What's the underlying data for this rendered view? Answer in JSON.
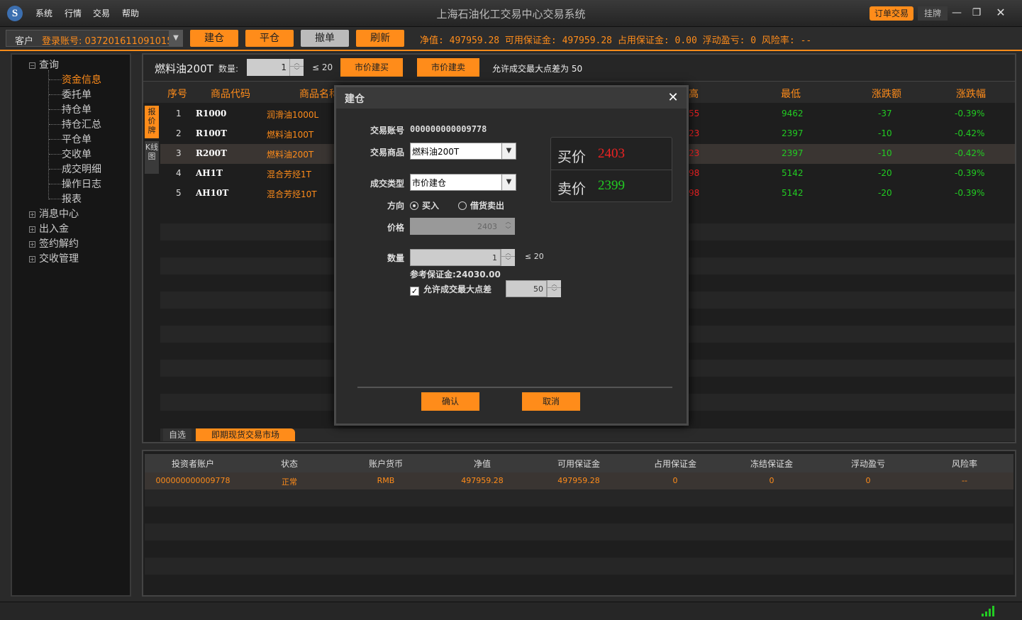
{
  "window": {
    "title": "上海石油化工交易中心交易系统",
    "menu": [
      "系统",
      "行情",
      "交易",
      "帮助"
    ],
    "tab_order": "订单交易",
    "tab_hang": "挂牌"
  },
  "toolbar": {
    "client_label": "客户",
    "account_text": "登录账号: 037201611091015",
    "btn_open": "建仓",
    "btn_close": "平仓",
    "btn_withdraw": "撤单",
    "btn_refresh": "刷新",
    "summary": "净值: 497959.28 可用保证金: 497959.28 占用保证金: 0.00 浮动盈亏: 0 风险率: --"
  },
  "sidebar": {
    "query": "查询",
    "children": [
      "资金信息",
      "委托单",
      "持仓单",
      "持仓汇总",
      "平仓单",
      "交收单",
      "成交明细",
      "操作日志",
      "报表"
    ],
    "groups": [
      "消息中心",
      "出入金",
      "签约解约",
      "交收管理"
    ]
  },
  "order_bar": {
    "product": "燃料油200T",
    "qty_label": "数量:",
    "qty_value": "1",
    "qty_max": "≤ 20",
    "btn_buy": "市价建买",
    "btn_sell": "市价建卖",
    "allow_text": "允许成交最大点差为 50"
  },
  "quote_table": {
    "headers": [
      "序号",
      "商品代码",
      "商品名称",
      "高",
      "最低",
      "涨跌额",
      "涨跌幅"
    ],
    "rows": [
      {
        "no": "1",
        "code": "R1000",
        "name": "润滑油1000L",
        "high": "55",
        "low": "9462",
        "chg": "-37",
        "pct": "-0.39%"
      },
      {
        "no": "2",
        "code": "R100T",
        "name": "燃料油100T",
        "high": "23",
        "low": "2397",
        "chg": "-10",
        "pct": "-0.42%"
      },
      {
        "no": "3",
        "code": "R200T",
        "name": "燃料油200T",
        "high": "23",
        "low": "2397",
        "chg": "-10",
        "pct": "-0.42%"
      },
      {
        "no": "4",
        "code": "AH1T",
        "name": "混合芳烃1T",
        "high": "98",
        "low": "5142",
        "chg": "-20",
        "pct": "-0.39%"
      },
      {
        "no": "5",
        "code": "AH10T",
        "name": "混合芳烃10T",
        "high": "98",
        "low": "5142",
        "chg": "-20",
        "pct": "-0.39%"
      }
    ],
    "side_tab1": "报价牌",
    "side_tab2": "K线图",
    "tab_self": "自选",
    "tab_market": "即期现货交易市场"
  },
  "account_table": {
    "headers": [
      "投资者账户",
      "状态",
      "账户货币",
      "净值",
      "可用保证金",
      "占用保证金",
      "冻结保证金",
      "浮动盈亏",
      "风险率"
    ],
    "row": [
      "000000000009778",
      "正常",
      "RMB",
      "497959.28",
      "497959.28",
      "0",
      "0",
      "0",
      "--"
    ]
  },
  "dialog": {
    "title": "建仓",
    "close": "✕",
    "account_label": "交易账号",
    "account_value": "000000000009778",
    "product_label": "交易商品",
    "product_value": "燃料油200T",
    "type_label": "成交类型",
    "type_value": "市价建仓",
    "direction_label": "方向",
    "dir_buy": "买入",
    "dir_sell": "借货卖出",
    "price_label": "价格",
    "price_value": "2403",
    "qty_label": "数量",
    "qty_value": "1",
    "qty_max": "≤ 20",
    "margin_ref": "参考保证金:24030.00",
    "allow_label": "允许成交最大点差",
    "allow_value": "50",
    "buy_label": "买价",
    "buy_price": "2403",
    "sell_label": "卖价",
    "sell_price": "2399",
    "btn_ok": "确认",
    "btn_cancel": "取消"
  },
  "colors": {
    "accent": "#ff8c1a",
    "up": "#e22222",
    "down": "#22cc22"
  }
}
